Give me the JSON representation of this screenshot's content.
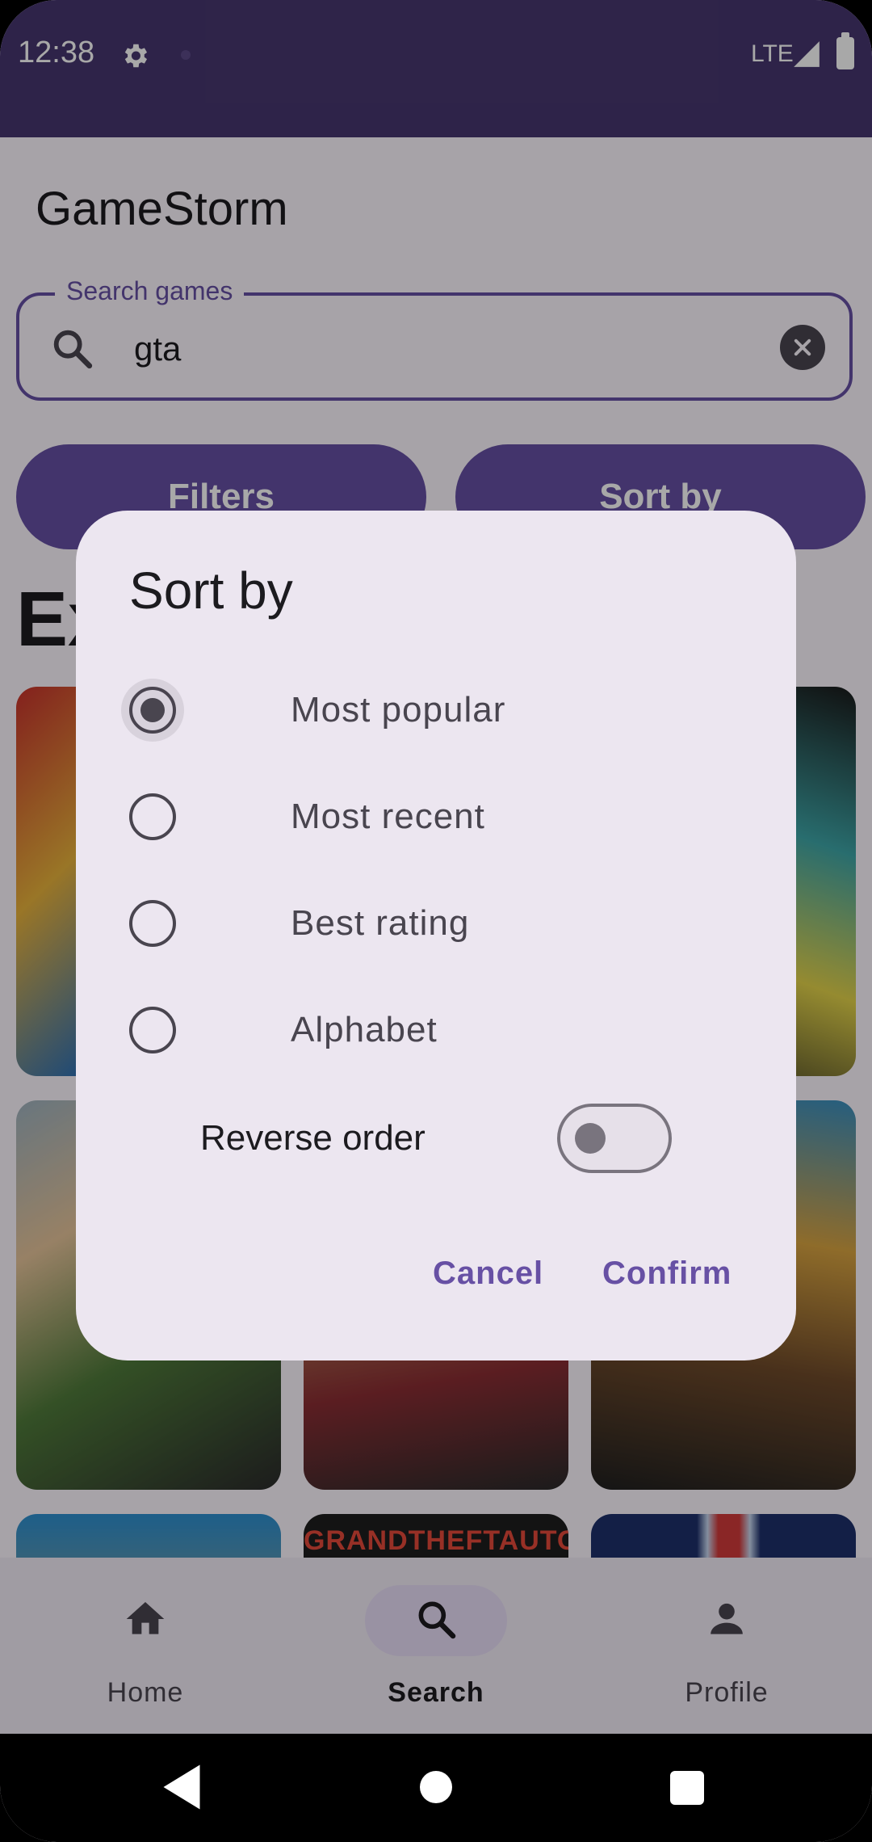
{
  "status_bar": {
    "time": "12:38",
    "network": "LTE",
    "settings_icon": "gear-icon",
    "signal_icon": "signal-icon",
    "battery_icon": "battery-icon"
  },
  "app": {
    "title": "GameStorm"
  },
  "search": {
    "label": "Search games",
    "value": "gta",
    "icon": "search-icon",
    "clear_icon": "clear-icon"
  },
  "actions": {
    "filters_label": "Filters",
    "sort_label": "Sort by"
  },
  "section": {
    "title": "Ex"
  },
  "results": [
    {
      "label": ""
    },
    {
      "label": ""
    },
    {
      "label": ""
    },
    {
      "label": ""
    },
    {
      "label": ""
    },
    {
      "label": ""
    },
    {
      "label": ""
    },
    {
      "label": "GRANDTHEFTAUTO"
    },
    {
      "label": ""
    }
  ],
  "colors": {
    "primary": "#6750a4",
    "status_bar": "#47366f",
    "dialog_bg": "#ece6f0",
    "nav_active": "#e8def8"
  },
  "bottom_nav": {
    "items": [
      {
        "label": "Home",
        "icon": "home-icon",
        "active": false
      },
      {
        "label": "Search",
        "icon": "search-icon",
        "active": true
      },
      {
        "label": "Profile",
        "icon": "person-icon",
        "active": false
      }
    ]
  },
  "dialog": {
    "title": "Sort by",
    "options": [
      {
        "label": "Most popular",
        "selected": true
      },
      {
        "label": "Most recent",
        "selected": false
      },
      {
        "label": "Best rating",
        "selected": false
      },
      {
        "label": "Alphabet",
        "selected": false
      }
    ],
    "reverse_label": "Reverse order",
    "reverse_enabled": false,
    "cancel_label": "Cancel",
    "confirm_label": "Confirm"
  }
}
